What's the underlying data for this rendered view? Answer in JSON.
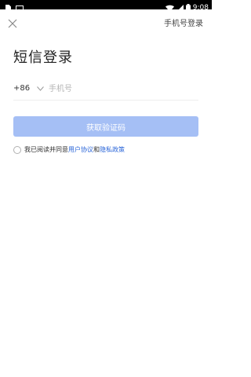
{
  "status_bar": {
    "time": "9:08",
    "icons": [
      "sim-card-icon",
      "image-icon",
      "wifi-icon",
      "signal-icon",
      "battery-icon"
    ]
  },
  "header": {
    "close_icon": "close-icon",
    "sms_login": "手机号登录"
  },
  "title": "短信登录",
  "phone": {
    "country_code": "+86",
    "placeholder": "手机号",
    "value": ""
  },
  "get_code_button": "获取验证码",
  "agreement": {
    "prefix": "我已阅读并同意",
    "user_agreement": "用户协议",
    "and": "和",
    "privacy_policy": "隐私政策"
  },
  "colors": {
    "accent_disabled": "#a5bff5",
    "link": "#2a65d8"
  }
}
